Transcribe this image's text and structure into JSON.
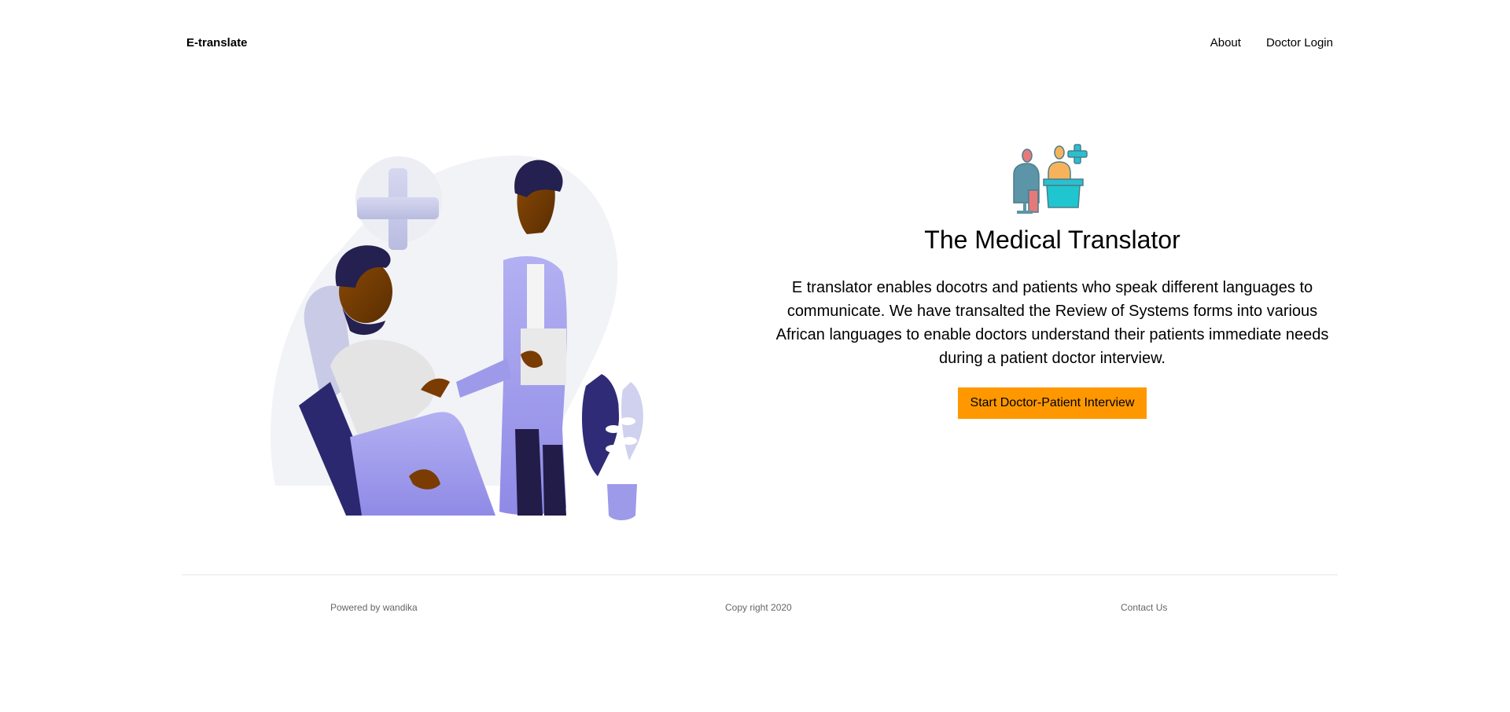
{
  "nav": {
    "brand": "E-translate",
    "links": [
      "About",
      "Doctor Login"
    ]
  },
  "hero": {
    "illustration_icon": "doctor-patient-illustration",
    "logo_icon": "doctor-patient-consultation-icon",
    "title": "The Medical Translator",
    "description": "E translator enables docotrs and patients who speak different languages to communicate. We have transalted the Review of Systems forms into various African languages to enable doctors understand their patients immediate needs during a patient doctor interview.",
    "cta_label": "Start Doctor-Patient Interview"
  },
  "footer": {
    "powered_by": "Powered by wandika",
    "copyright": "Copy right 2020",
    "contact": "Contact Us"
  },
  "colors": {
    "accent": "#FF9800",
    "footer_text": "#666666",
    "illustration_purple": "#9E9AEA",
    "illustration_navy": "#25215A"
  }
}
